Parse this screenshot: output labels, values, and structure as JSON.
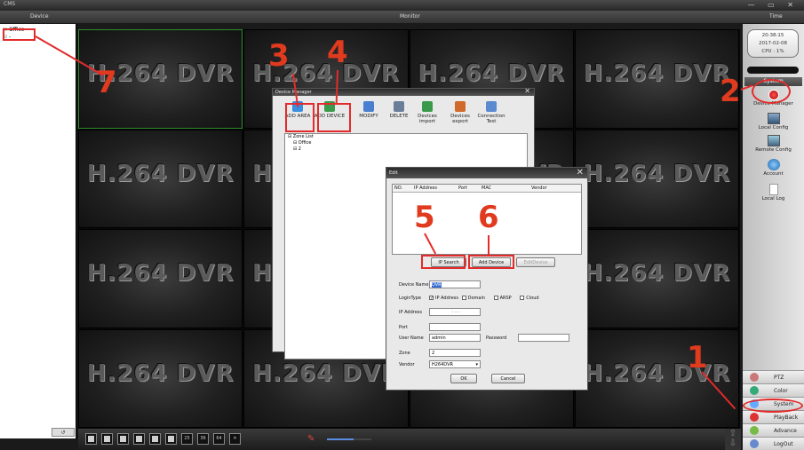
{
  "app": {
    "title": "CMS",
    "window_controls": "— ▭ ✕"
  },
  "header": {
    "device": "Device",
    "monitor": "Monitor",
    "time": "Time"
  },
  "tree": {
    "items": [
      {
        "label": "Office",
        "selected": true
      },
      {
        "label": "-"
      }
    ]
  },
  "video": {
    "overlay_text": "H.264 DVR",
    "rows": 4,
    "cols": 4,
    "selected_cell": 0
  },
  "side": {
    "clock_time": "20:38:15",
    "clock_date": "2017-02-08",
    "cpu": "CPU : 1%",
    "system_header": "System",
    "items": [
      {
        "label": "Device Manager",
        "icon": "device-manager-icon"
      },
      {
        "label": "Local Config",
        "icon": "local-config-icon"
      },
      {
        "label": "Remote Config",
        "icon": "remote-config-icon"
      },
      {
        "label": "Account",
        "icon": "account-icon"
      },
      {
        "label": "Local Log",
        "icon": "local-log-icon"
      }
    ],
    "bottom": [
      {
        "label": "PTZ",
        "color": "#c77"
      },
      {
        "label": "Color",
        "color": "#3a7"
      },
      {
        "label": "System",
        "color": "#6af"
      },
      {
        "label": "PlayBack",
        "color": "#d33"
      },
      {
        "label": "Advance",
        "color": "#7b4"
      },
      {
        "label": "LogOut",
        "color": "#68c"
      }
    ]
  },
  "bottombar": {
    "layouts": [
      "1",
      "4",
      "8",
      "9",
      "10",
      "16",
      "25",
      "36",
      "64"
    ],
    "volume_percent": 60
  },
  "device_manager": {
    "title": "Device Manager",
    "toolbar": [
      "ADD AREA",
      "ADD DEVICE",
      "MODIFY",
      "DELETE",
      "Devices import",
      "Devices export",
      "Connection Test"
    ],
    "zone_tree": [
      "Zone List",
      "Office",
      "2"
    ]
  },
  "edit": {
    "title": "Edit",
    "columns": [
      "NO.",
      "IP Address",
      "Port",
      "MAC",
      "Vendor"
    ],
    "ip_search": "IP Search",
    "add_device": "Add Device",
    "edit_device": "EditDevice",
    "device_name_label": "Device Name",
    "device_name_value": "DVR",
    "login_type_label": "LoginType",
    "login_options": [
      "IP Address",
      "Domain",
      "ARSP",
      "Cloud"
    ],
    "ip_label": "IP Address",
    "ip_value": "·    ·    ·",
    "port_label": "Port",
    "username_label": "User Name",
    "username_value": "admin",
    "password_label": "Password",
    "zone_label": "Zone",
    "zone_value": "2",
    "vendor_label": "Vendor",
    "vendor_value": "H264DVR",
    "ok": "OK",
    "cancel": "Cancel"
  },
  "annotations": [
    "1",
    "2",
    "3",
    "4",
    "5",
    "6",
    "7"
  ],
  "colors": {
    "annotation": "#e32b2b",
    "selected_cell_border": "#2d8a2d"
  }
}
